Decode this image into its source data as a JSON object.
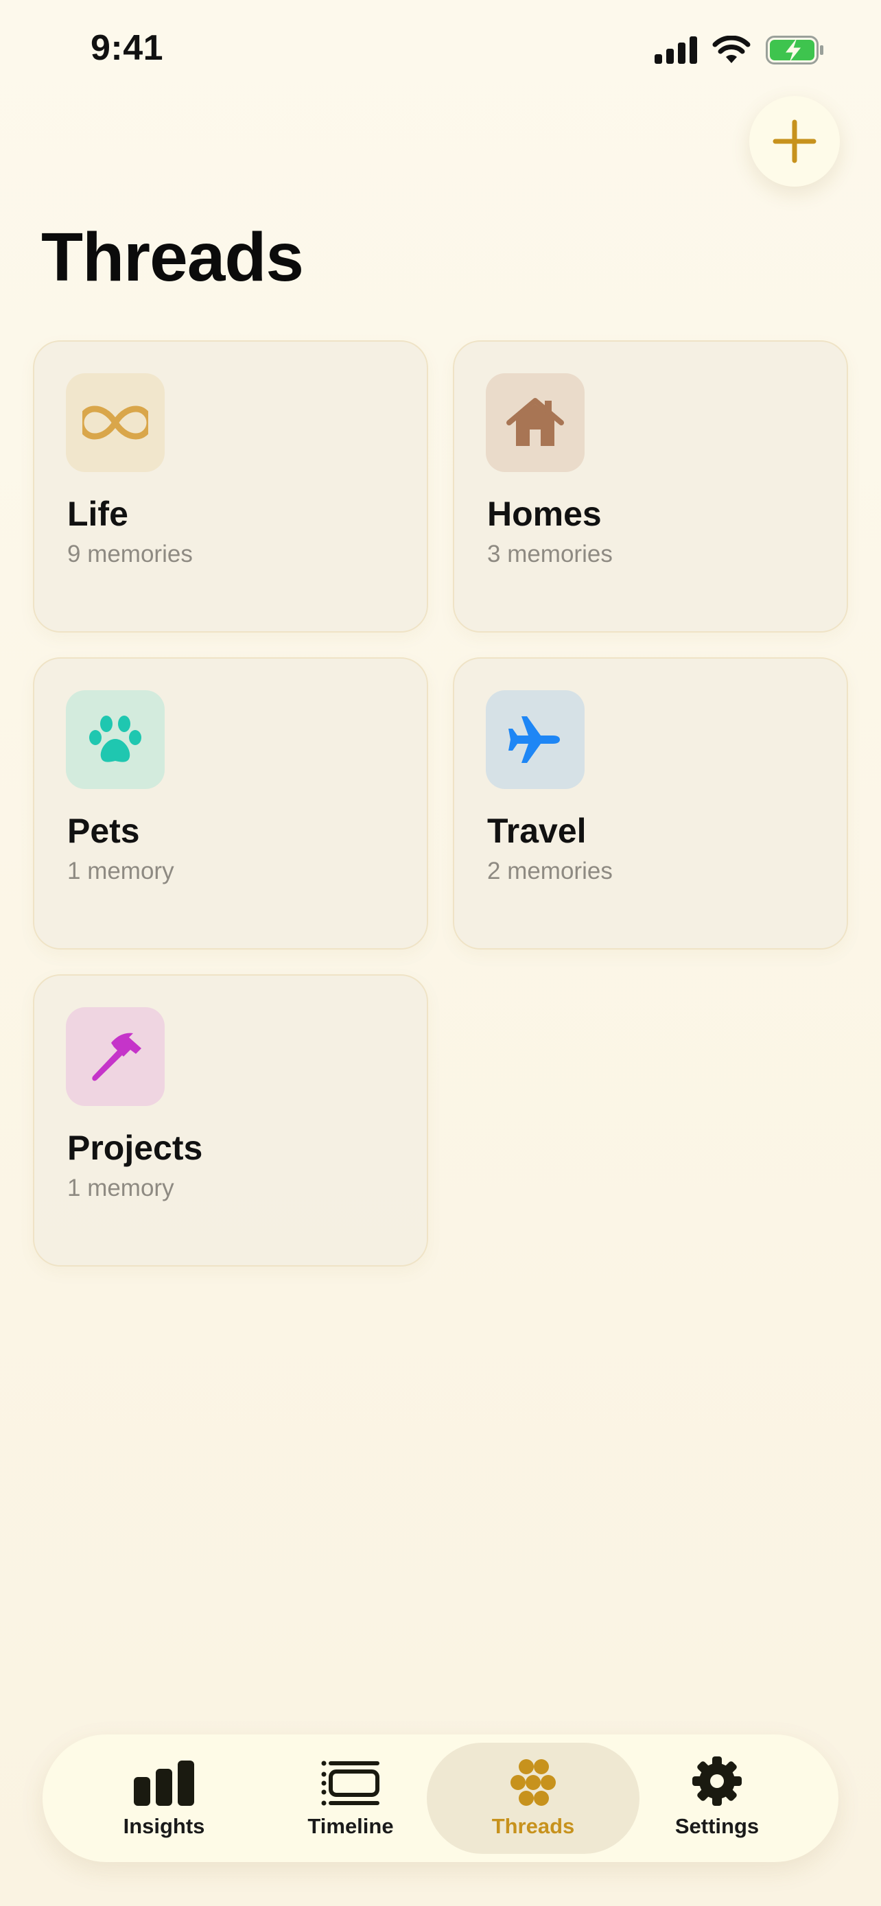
{
  "status_bar": {
    "time": "9:41"
  },
  "header": {
    "title": "Threads"
  },
  "threads": [
    {
      "name": "Life",
      "count": "9 memories"
    },
    {
      "name": "Homes",
      "count": "3 memories"
    },
    {
      "name": "Pets",
      "count": "1 memory"
    },
    {
      "name": "Travel",
      "count": "2 memories"
    },
    {
      "name": "Projects",
      "count": "1 memory"
    }
  ],
  "tabbar": {
    "tabs": [
      {
        "label": "Insights"
      },
      {
        "label": "Timeline"
      },
      {
        "label": "Threads",
        "active": true
      },
      {
        "label": "Settings"
      }
    ]
  },
  "colors": {
    "accent": "#c7921d",
    "life": "#d9a64a",
    "homes": "#a87554",
    "pets": "#1fc7b0",
    "travel": "#1e86f5",
    "projects": "#c534c9"
  }
}
